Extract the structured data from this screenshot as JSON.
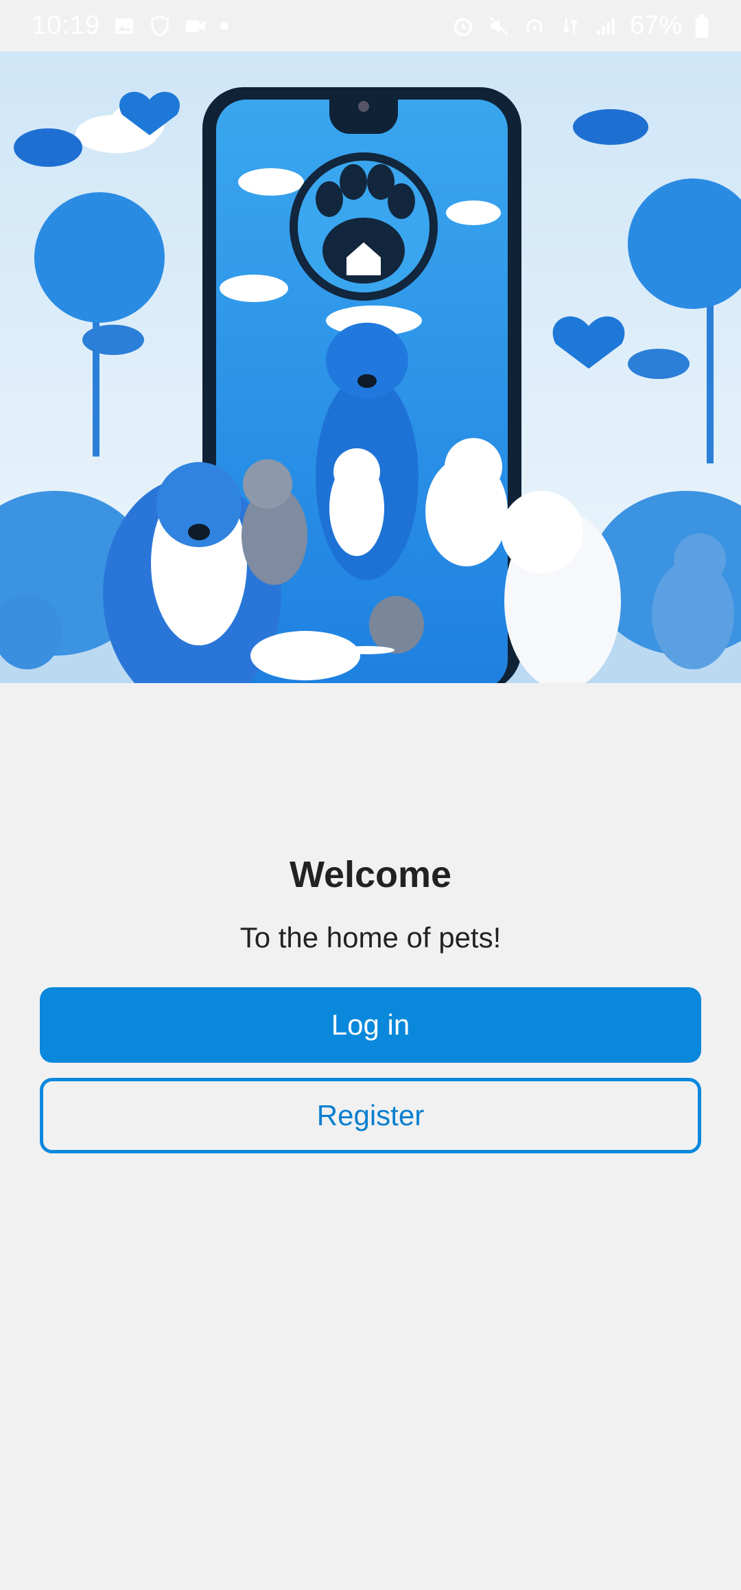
{
  "status_bar": {
    "time": "10:19",
    "battery_percent": "67%",
    "left_icons": [
      "gallery-icon",
      "shield-hand-icon",
      "video-camera-icon",
      "dot-icon"
    ],
    "right_icons": [
      "alarm-icon",
      "mute-icon",
      "hotspot-icon",
      "data-icon",
      "signal-icon",
      "battery-icon"
    ]
  },
  "hero": {
    "illustration": "pet-app-hero-illustration",
    "colors": {
      "primary": "#1e78d8",
      "light": "#cde4f6",
      "accent": "#0a88dc"
    }
  },
  "welcome": {
    "title": "Welcome",
    "subtitle": "To the home of pets!"
  },
  "actions": {
    "login_label": "Log in",
    "register_label": "Register"
  },
  "colors": {
    "background": "#f1f1f2",
    "primary_button": "#0a88dc",
    "text": "#222222"
  }
}
